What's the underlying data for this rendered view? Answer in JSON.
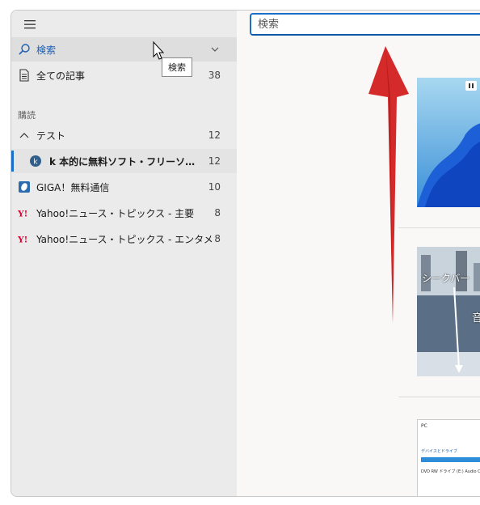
{
  "sidebar": {
    "search_label": "検索",
    "all_articles": {
      "label": "全ての記事",
      "count": "38"
    },
    "section_title": "購読",
    "folder": {
      "label": "テスト",
      "count": "12"
    },
    "feeds": [
      {
        "label": "k 本的に無料ソフト・フリーソフト 更新...",
        "count": "12"
      },
      {
        "label": "GIGA！無料通信",
        "count": "10"
      },
      {
        "label": "Yahoo!ニュース・トピックス - 主要",
        "count": "8"
      },
      {
        "label": "Yahoo!ニュース・トピックス - エンタメ",
        "count": "8"
      }
    ]
  },
  "tooltip": "検索",
  "search": {
    "placeholder": "検索",
    "value": ""
  },
  "thumbnails": [
    {
      "caption": "シークバー",
      "caption2": "音"
    },
    {
      "folder_title": "PC",
      "section": "デバイスとドライブ",
      "item": "DVD RW ドライブ (E:) Audio CD"
    }
  ],
  "colors": {
    "accent": "#1a6fc9",
    "arrow": "#d42a2a",
    "yahoo": "#e60033"
  }
}
